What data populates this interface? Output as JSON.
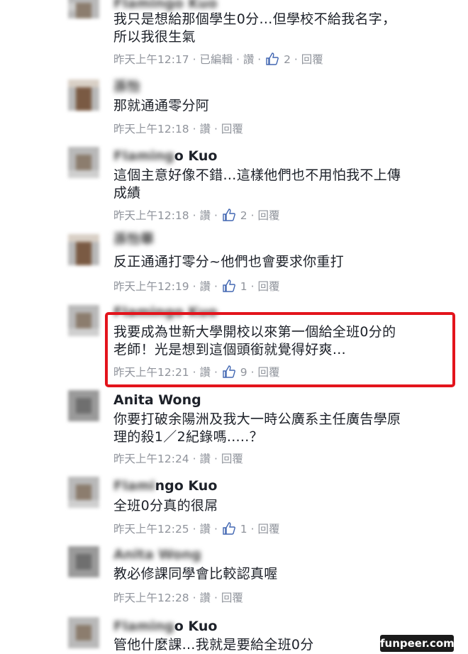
{
  "comments": [
    {
      "author_visible": "",
      "author_blurred": "Flamingo Kuo",
      "body": [
        "我只是想給那個學生0分…但學校不給我名字，",
        "所以我很生氣"
      ],
      "meta": {
        "time": "昨天上午12:17",
        "edited": "已編輯",
        "like": "讚",
        "likes": "2",
        "reply": "回覆"
      }
    },
    {
      "author_visible": "",
      "author_blurred": "孫怡",
      "body": [
        "那就通通零分阿"
      ],
      "meta": {
        "time": "昨天上午12:18",
        "like": "讚",
        "reply": "回覆"
      }
    },
    {
      "author_visible": "o Kuo",
      "author_blurred": "Flaming",
      "body": [
        "這個主意好像不錯…這樣他們也不用怕我不上傳",
        "成績"
      ],
      "meta": {
        "time": "昨天上午12:18",
        "like": "讚",
        "likes": "2",
        "reply": "回覆"
      }
    },
    {
      "author_visible": "",
      "author_blurred": "孫怡華",
      "body": [
        "反正通通打零分~他們也會要求你重打"
      ],
      "meta": {
        "time": "昨天上午12:19",
        "like": "讚",
        "likes": "1",
        "reply": "回覆"
      }
    },
    {
      "author_visible": "",
      "author_blurred": "Flamingo Kuo",
      "body": [
        "我要成為世新大學開校以來第一個給全班0分的",
        "老師！光是想到這個頭銜就覺得好爽…"
      ],
      "meta": {
        "time": "昨天上午12:21",
        "like": "讚",
        "likes": "9",
        "reply": "回覆"
      }
    },
    {
      "author_visible": "Anita Wong",
      "author_blurred": "",
      "body": [
        "你要打破余陽洲及我大一時公廣系主任廣告學原",
        "理的殺1／2紀錄嗎.....？"
      ],
      "meta": {
        "time": "昨天上午12:24",
        "like": "讚",
        "reply": "回覆"
      }
    },
    {
      "author_visible": "ngo Kuo",
      "author_blurred": "Flami",
      "body": [
        "全班0分真的很屌"
      ],
      "meta": {
        "time": "昨天上午12:25",
        "like": "讚",
        "likes": "1",
        "reply": "回覆"
      }
    },
    {
      "author_visible": "",
      "author_blurred": "Anita Wong",
      "body": [
        "教必修課同學會比較認真喔"
      ],
      "meta": {
        "time": "昨天上午12:28",
        "like": "讚",
        "reply": "回覆"
      }
    },
    {
      "author_visible": "o Kuo",
      "author_blurred": "Flaming",
      "body": [
        "管他什麼課…我就是要給全班0分"
      ],
      "meta": {}
    }
  ],
  "watermark": "funpeer.com",
  "colors": {
    "highlight": "#e3141c",
    "meta": "#90949c",
    "like_icon": "#4267b2"
  }
}
